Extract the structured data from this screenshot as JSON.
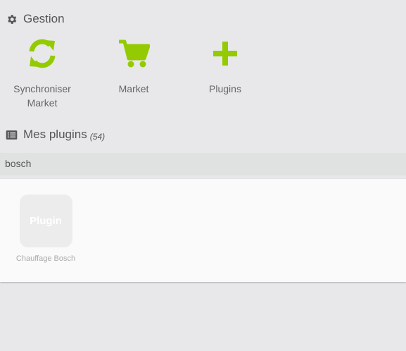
{
  "gestion": {
    "title": "Gestion",
    "items": [
      {
        "label_line1": "Synchroniser",
        "label_line2": "Market",
        "icon": "sync-icon"
      },
      {
        "label": "Market",
        "icon": "cart-icon"
      },
      {
        "label": "Plugins",
        "icon": "plus-icon"
      }
    ]
  },
  "mes_plugins": {
    "title": "Mes plugins",
    "count": "(54)",
    "icon": "list-icon"
  },
  "search": {
    "value": "bosch"
  },
  "plugins": [
    {
      "thumb_text": "Plugin",
      "name": "Chauffage Bosch"
    }
  ],
  "colors": {
    "accent": "#94ca02",
    "background": "#e8e8ea",
    "panel": "#fafafa"
  }
}
